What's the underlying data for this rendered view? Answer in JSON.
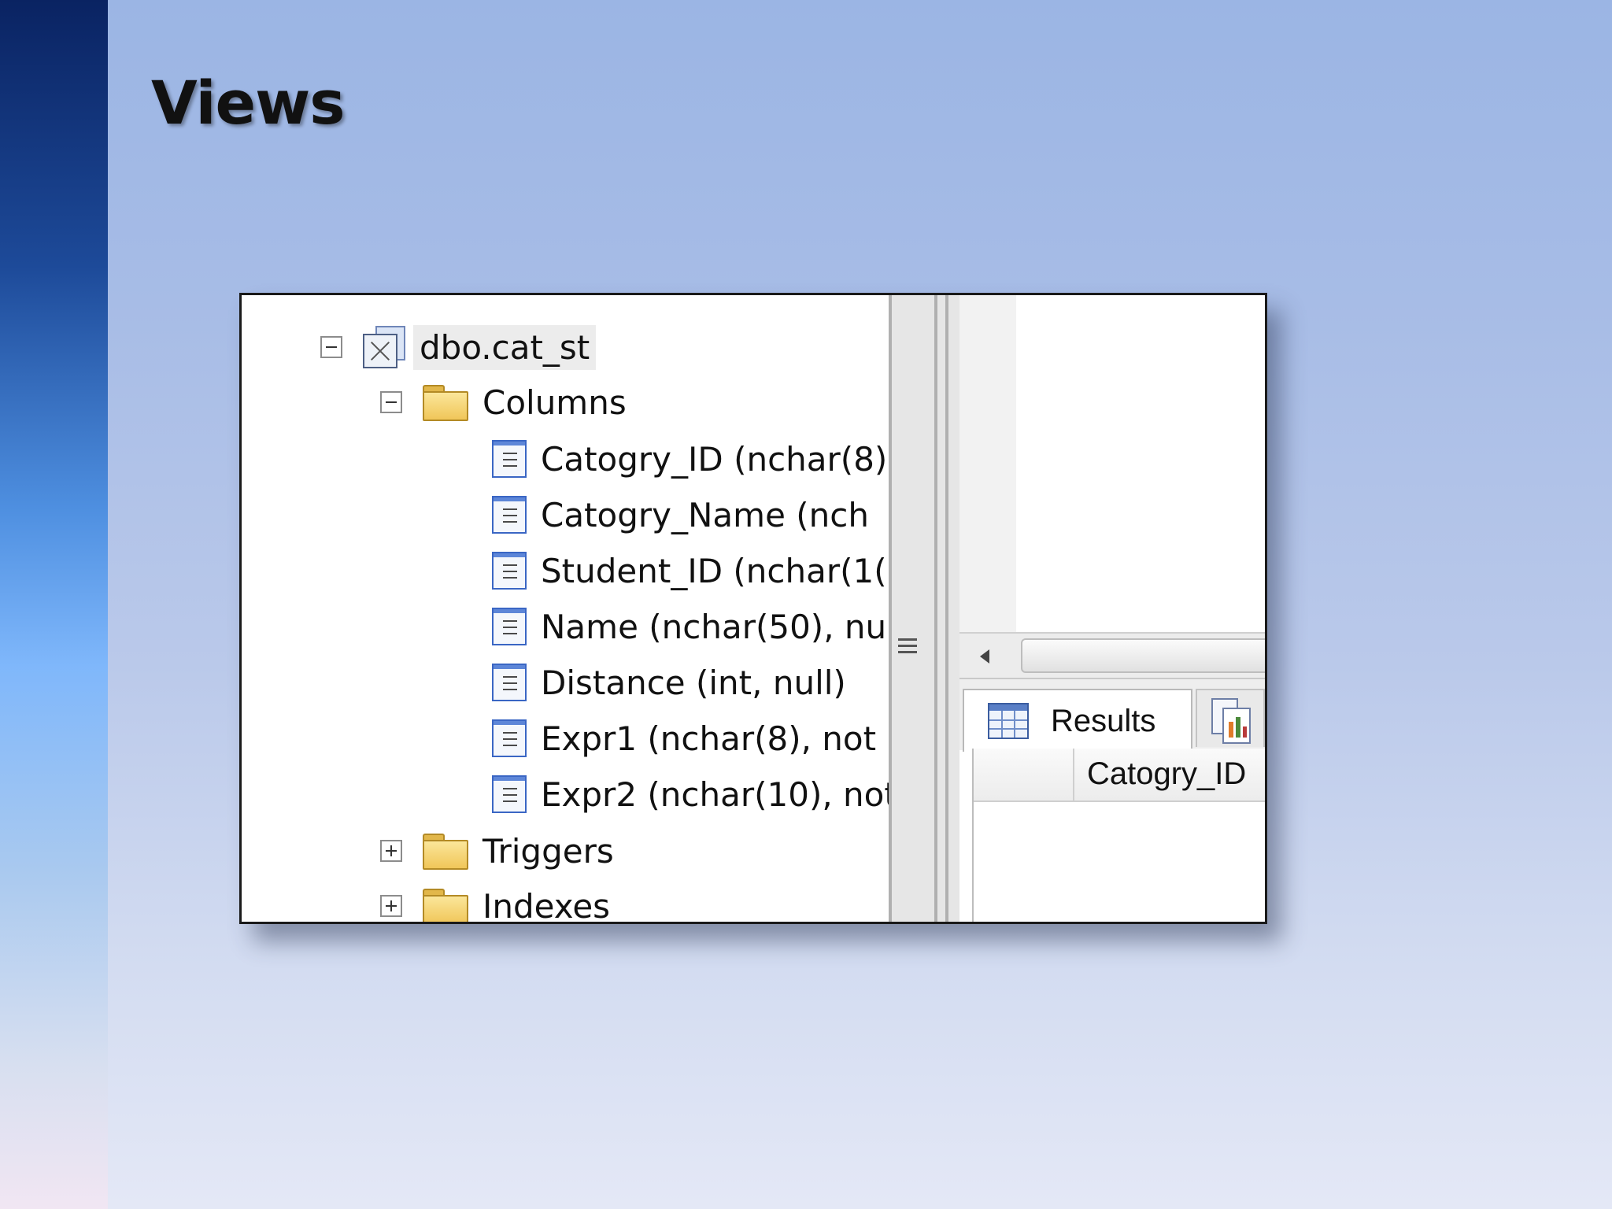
{
  "slide": {
    "title": "Views"
  },
  "tree": {
    "view_node": "dbo.cat_st",
    "columns_folder": "Columns",
    "columns": [
      "Catogry_ID (nchar(8)",
      "Catogry_Name (nch",
      "Student_ID (nchar(1(",
      "Name (nchar(50), nu",
      "Distance (int, null)",
      "Expr1 (nchar(8), not",
      "Expr2 (nchar(10), not"
    ],
    "triggers_folder": "Triggers",
    "indexes_folder": "Indexes"
  },
  "results_pane": {
    "tab_results": "Results",
    "grid_columns": [
      "Catogry_ID"
    ]
  },
  "icons": {
    "view": "view-icon",
    "folder": "folder-icon",
    "column": "column-icon",
    "grid": "grid-icon",
    "messages": "messages-icon"
  },
  "colors": {
    "left_bar_top": "#0a2362",
    "background": "#a7bce6",
    "folder": "#f0c659",
    "column_icon": "#3a66c4"
  }
}
